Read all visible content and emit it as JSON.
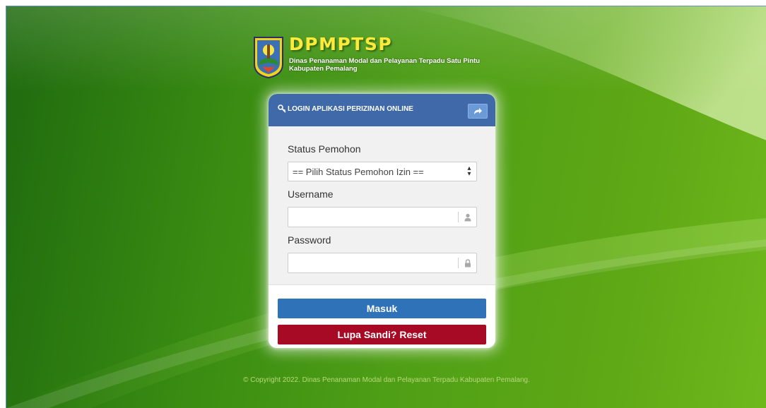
{
  "brand": {
    "title": "DPMPTSP",
    "subtitle_line1": "Dinas Penanaman Modal dan Pelayanan Terpadu Satu Pintu",
    "subtitle_line2": "Kabupaten Pemalang"
  },
  "login_panel": {
    "title": "LOGIN APLIKASI PERIZINAN ONLINE",
    "icons": {
      "title_icon": "key-icon",
      "share_button_icon": "share-arrow-icon"
    },
    "status_field": {
      "label": "Status Pemohon",
      "selected": "== Pilih Status Pemohon Izin =="
    },
    "username_field": {
      "label": "Username",
      "value": "",
      "icon": "user-icon"
    },
    "password_field": {
      "label": "Password",
      "value": "",
      "icon": "lock-icon"
    },
    "login_button": "Masuk",
    "reset_button": "Lupa Sandi? Reset"
  },
  "footer": {
    "copyright": "© Copyright 2022. Dinas Penanaman Modal dan Pelayanan Terpadu Kabupaten Pemalang."
  },
  "colors": {
    "header_blue": "#3f69a8",
    "login_button": "#2f72b7",
    "reset_button": "#a70a25",
    "brand_yellow": "#ffe93a",
    "background_green": "#4f9f16"
  }
}
